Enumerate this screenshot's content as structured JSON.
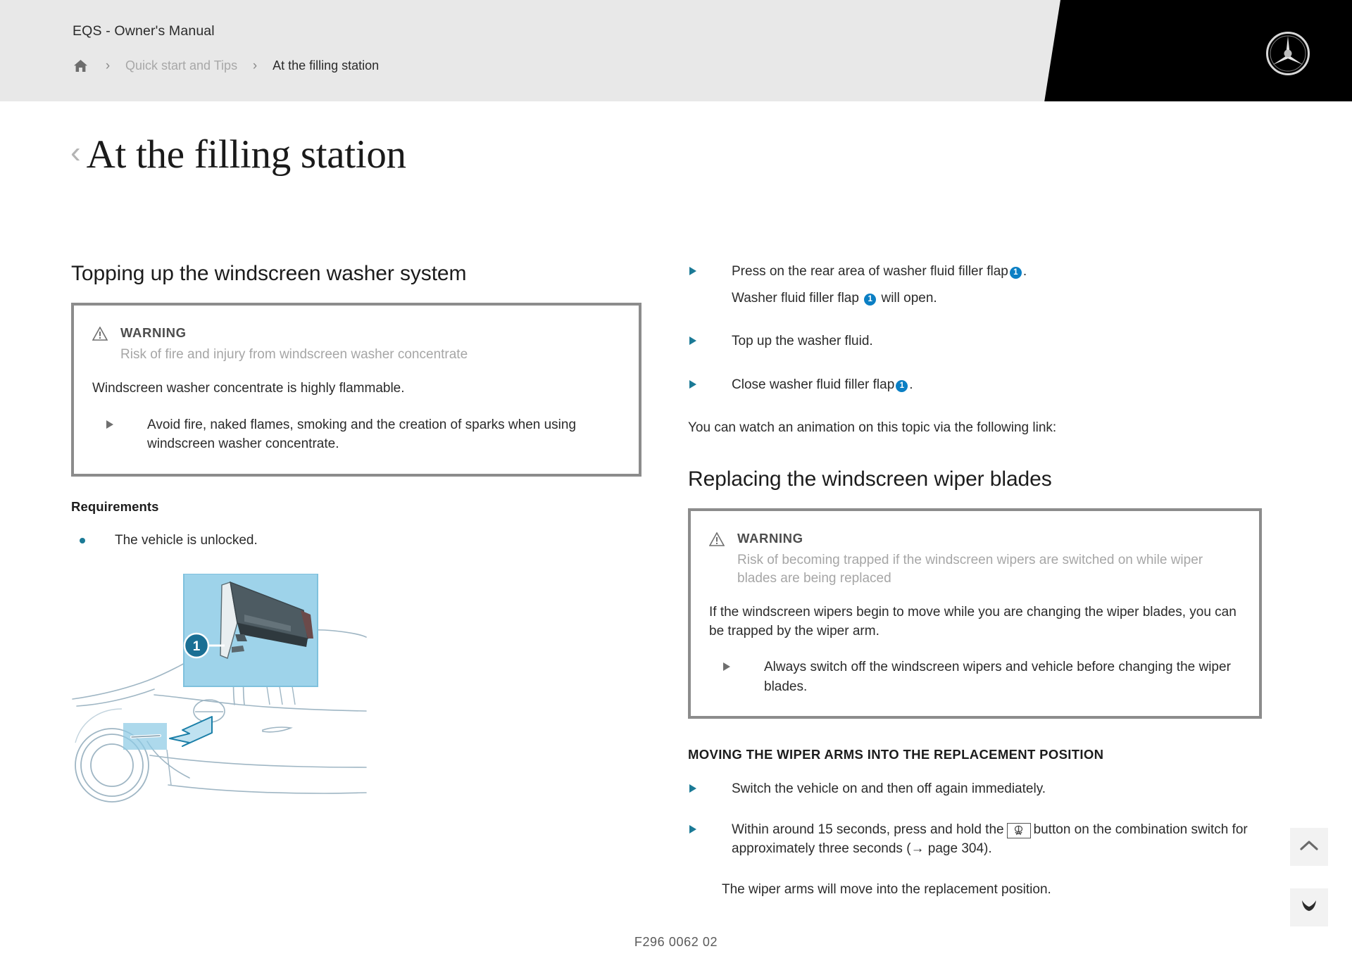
{
  "header": {
    "brand_title": "EQS - Owner's Manual",
    "breadcrumb": {
      "home_icon": "home-icon",
      "separator": "›",
      "items": [
        {
          "label": "Quick start and Tips",
          "current": false
        },
        {
          "label": "At the filling station",
          "current": true
        }
      ]
    },
    "logo_name": "mercedes-benz-star-logo"
  },
  "page": {
    "back_chevron": "‹",
    "title": "At the filling station"
  },
  "left_column": {
    "section_title": "Topping up the windscreen washer system",
    "warning": {
      "icon": "warning-triangle-icon",
      "label": "WARNING",
      "subtitle": "Risk of fire and injury from windscreen washer concentrate",
      "body": "Windscreen washer concentrate is highly flammable.",
      "bullets": [
        "Avoid fire, naked flames, smoking and the creation of sparks when using windscreen washer concentrate."
      ]
    },
    "requirements": {
      "heading": "Requirements",
      "items": [
        "The vehicle is unlocked."
      ]
    },
    "figure": {
      "name": "washer-fluid-filler-flap-illustration",
      "callout_number": "1"
    }
  },
  "right_column": {
    "steps": [
      {
        "text_before": "Press on the rear area of washer fluid filler flap",
        "ref": "1",
        "text_after": ".",
        "sub_before": "Washer fluid filler flap",
        "sub_ref": "1",
        "sub_after": "will open."
      },
      {
        "text_before": "Top up the washer fluid.",
        "ref": null,
        "text_after": ""
      },
      {
        "text_before": "Close washer fluid filler flap",
        "ref": "1",
        "text_after": "."
      }
    ],
    "animation_note": "You can watch an animation on this topic via the following link:",
    "section_title": "Replacing the windscreen wiper blades",
    "warning": {
      "icon": "warning-triangle-icon",
      "label": "WARNING",
      "subtitle": "Risk of becoming trapped if the windscreen wipers are switched on while wiper blades are being replaced",
      "body": "If the windscreen wipers begin to move while you are changing the wiper blades, you can be trapped by the wiper arm.",
      "bullets": [
        "Always switch off the windscreen wipers and vehicle before changing the wiper blades."
      ]
    },
    "sub_heading": "MOVING THE WIPER ARMS INTO THE REPLACEMENT POSITION",
    "steps2": [
      {
        "text": "Switch the vehicle on and then off again immediately."
      }
    ],
    "step2_part1": "Within around 15 seconds, press and hold the",
    "step2_key_icon": "windscreen-wiper-button-icon",
    "step2_part2": "button on the combination switch for approximately three seconds (→ page 304).",
    "step2_follow": "The wiper arms will move into the replacement position."
  },
  "floating_buttons": [
    {
      "name": "scroll-to-top-button",
      "icon": "chevron-up-icon"
    },
    {
      "name": "bookmark-button",
      "icon": "bookmark-ribbon-icon"
    }
  ],
  "footer": {
    "code": "F296 0062 02"
  },
  "colors": {
    "header_bg": "#e8e8e8",
    "header_black": "#000000",
    "accent_blue": "#0b7fc4",
    "teal_bullet": "#1b7a96",
    "warn_border": "#8c8c8c",
    "muted_text": "#a6a6a6"
  }
}
